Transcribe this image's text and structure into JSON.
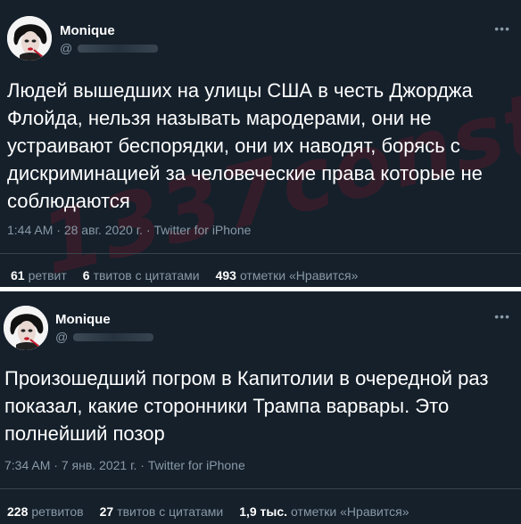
{
  "watermark": "1337const",
  "tweets": [
    {
      "author": "Monique",
      "handle": "@",
      "text": "Людей вышедших на улицы США в честь Джорджа Флойда, нельзя называть мародерами, они не устраивают беспорядки, они их наводят, борясь с дискриминацией за человеческие права которые не соблюдаются",
      "time": "1:44 AM",
      "date": "28 авг. 2020 г.",
      "sep": "·",
      "source": "Twitter for iPhone",
      "retweets": {
        "num": "61",
        "label": "ретвит"
      },
      "quotes": {
        "num": "6",
        "label": "твитов с цитатами"
      },
      "likes": {
        "num": "493",
        "label": "отметки «Нравится»"
      }
    },
    {
      "author": "Monique",
      "handle": "@",
      "text": "Произошедший погром в Капитолии в очередной раз показал, какие сторонники Трампа варвары. Это полнейший позор",
      "time": "7:34 AM",
      "date": "7 янв. 2021 г.",
      "sep": "·",
      "source": "Twitter for iPhone",
      "retweets": {
        "num": "228",
        "label": "ретвитов"
      },
      "quotes": {
        "num": "27",
        "label": "твитов с цитатами"
      },
      "likes": {
        "num": "1,9 тыс.",
        "label": "отметки «Нравится»"
      }
    }
  ],
  "icons": {
    "more": "more-horizontal-icon",
    "avatar": "profile-avatar"
  },
  "colors": {
    "background": "#15202b",
    "text": "#ffffff",
    "muted": "#8899a6",
    "divider": "#38444d"
  }
}
